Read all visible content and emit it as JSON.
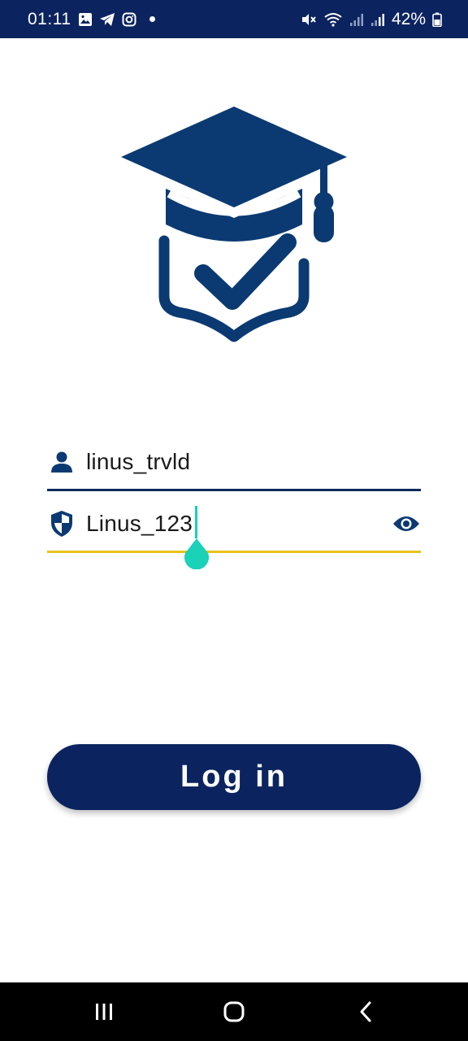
{
  "status_bar": {
    "time": "01:11",
    "battery": "42%",
    "icons_left": [
      "gallery-icon",
      "telegram-icon",
      "instagram-icon",
      "notification-dot"
    ],
    "icons_right": [
      "mute-icon",
      "wifi-icon",
      "signal-icon",
      "signal-icon",
      "battery-icon"
    ]
  },
  "logo": {
    "icon": "graduation-cap-shield-check-icon"
  },
  "form": {
    "username": {
      "value": "linus_trvld",
      "icon": "person-icon"
    },
    "password": {
      "value": "Linus_123",
      "icon": "shield-icon",
      "toggle_icon": "eye-icon"
    },
    "login_label": "Log in"
  },
  "nav": {
    "recents": "recents-icon",
    "home": "home-icon",
    "back": "back-icon"
  },
  "colors": {
    "primary": "#0b2460",
    "icon_blue": "#0b3a72",
    "accent_underline": "#e8c31a",
    "caret": "#1bd1b7"
  }
}
